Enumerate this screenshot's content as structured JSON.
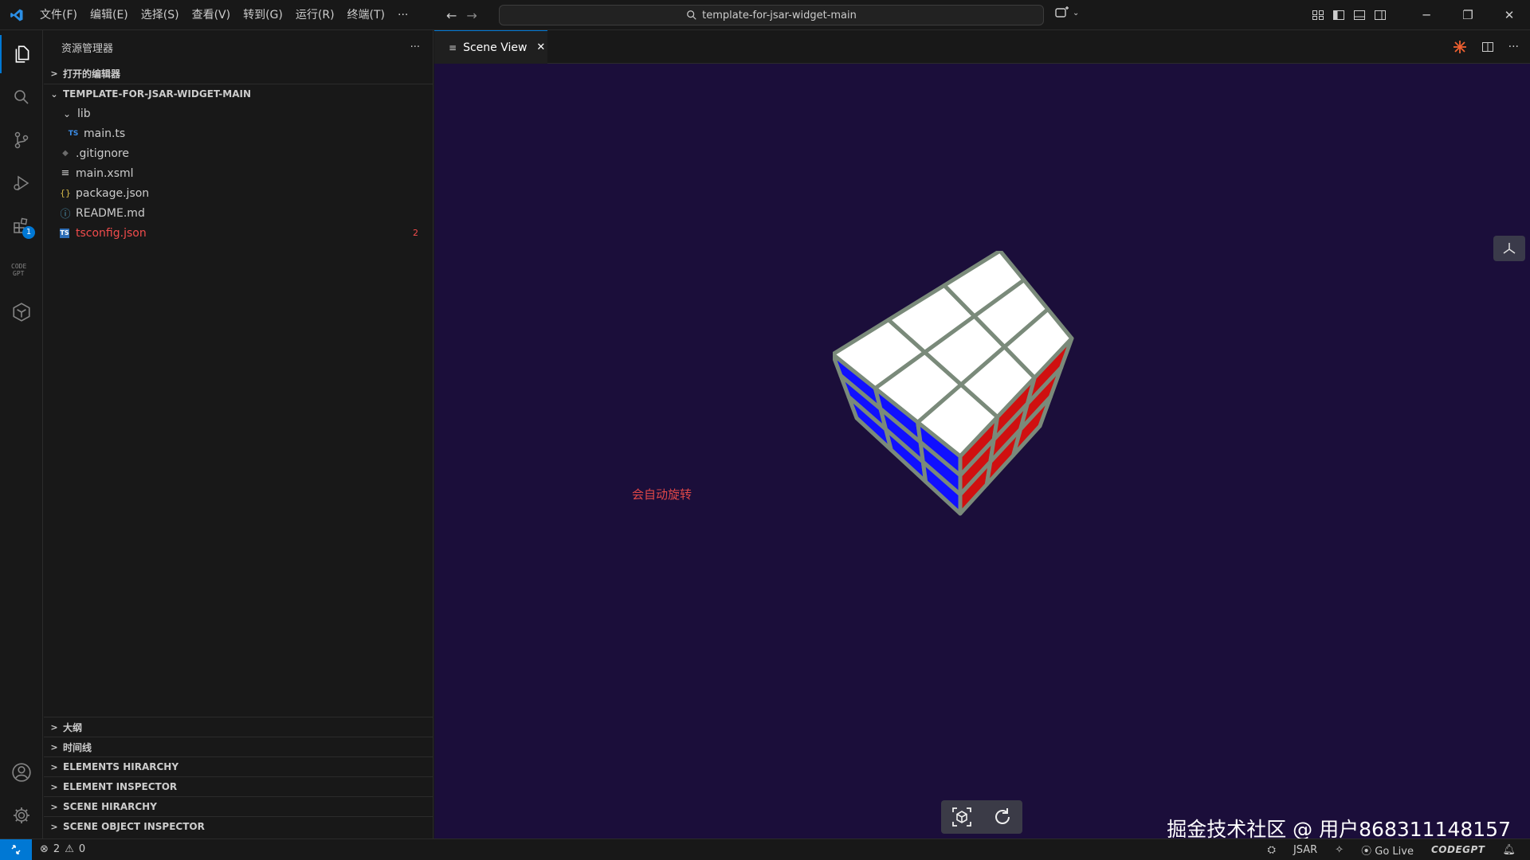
{
  "menu": [
    "文件(F)",
    "编辑(E)",
    "选择(S)",
    "查看(V)",
    "转到(G)",
    "运行(R)",
    "终端(T)",
    "···"
  ],
  "search": {
    "text": "template-for-jsar-widget-main"
  },
  "sidebar": {
    "title": "资源管理器",
    "more": "···",
    "open_editors": "打开的编辑器",
    "project": "TEMPLATE-FOR-JSAR-WIDGET-MAIN",
    "files": [
      {
        "name": "lib",
        "type": "folder",
        "icon": "chevron-down"
      },
      {
        "name": "main.ts",
        "type": "ts",
        "icon": "TS"
      },
      {
        "name": ".gitignore",
        "type": "git",
        "icon": "◆"
      },
      {
        "name": "main.xsml",
        "type": "xsml",
        "icon": "≡"
      },
      {
        "name": "package.json",
        "type": "json",
        "icon": "{}"
      },
      {
        "name": "README.md",
        "type": "md",
        "icon": "ⓘ"
      },
      {
        "name": "tsconfig.json",
        "type": "tsconfig",
        "icon": "TS",
        "problems": "2"
      }
    ],
    "bottom_sections": [
      "大纲",
      "时间线",
      "ELEMENTS HIRARCHY",
      "ELEMENT INSPECTOR",
      "SCENE HIRARCHY",
      "SCENE OBJECT INSPECTOR"
    ]
  },
  "activity": {
    "extensions_badge": "1"
  },
  "editor": {
    "tab_label": "Scene View",
    "scene_label": "会自动旋转",
    "watermark": "掘金技术社区 @ 用户868311148157",
    "cube_colors": {
      "top": "#ffffff",
      "left": "#1010ff",
      "right": "#d01010",
      "grid": "#7a8a7a"
    }
  },
  "status": {
    "errors": "2",
    "warnings": "0",
    "lang": "JSAR",
    "golive": "Go Live",
    "codegpt": "CODEGPT"
  },
  "colors": {
    "accent": "#0078d4",
    "scene_bg": "#1b0e3a",
    "error_text": "#e04848"
  }
}
